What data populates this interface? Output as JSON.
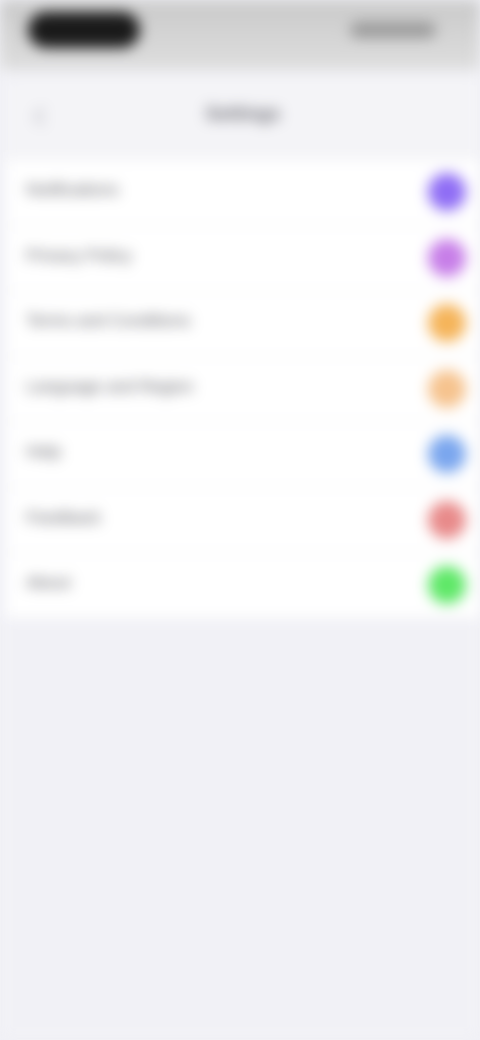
{
  "nav": {
    "title": "Settings"
  },
  "list": {
    "items": [
      {
        "label": "Notifications",
        "icon": "purple-circle-icon",
        "color": "#8f6df5"
      },
      {
        "label": "Privacy Policy",
        "icon": "violet-circle-icon",
        "color": "#c77ee8"
      },
      {
        "label": "Terms and Conditions",
        "icon": "orange-circle-icon",
        "color": "#f5b45a"
      },
      {
        "label": "Language and Region",
        "icon": "peach-circle-icon",
        "color": "#f6c38e"
      },
      {
        "label": "Help",
        "icon": "blue-circle-icon",
        "color": "#7aa6ee"
      },
      {
        "label": "Feedback",
        "icon": "red-circle-icon",
        "color": "#e88a8a"
      },
      {
        "label": "About",
        "icon": "green-circle-icon",
        "color": "#5fe868"
      }
    ]
  }
}
